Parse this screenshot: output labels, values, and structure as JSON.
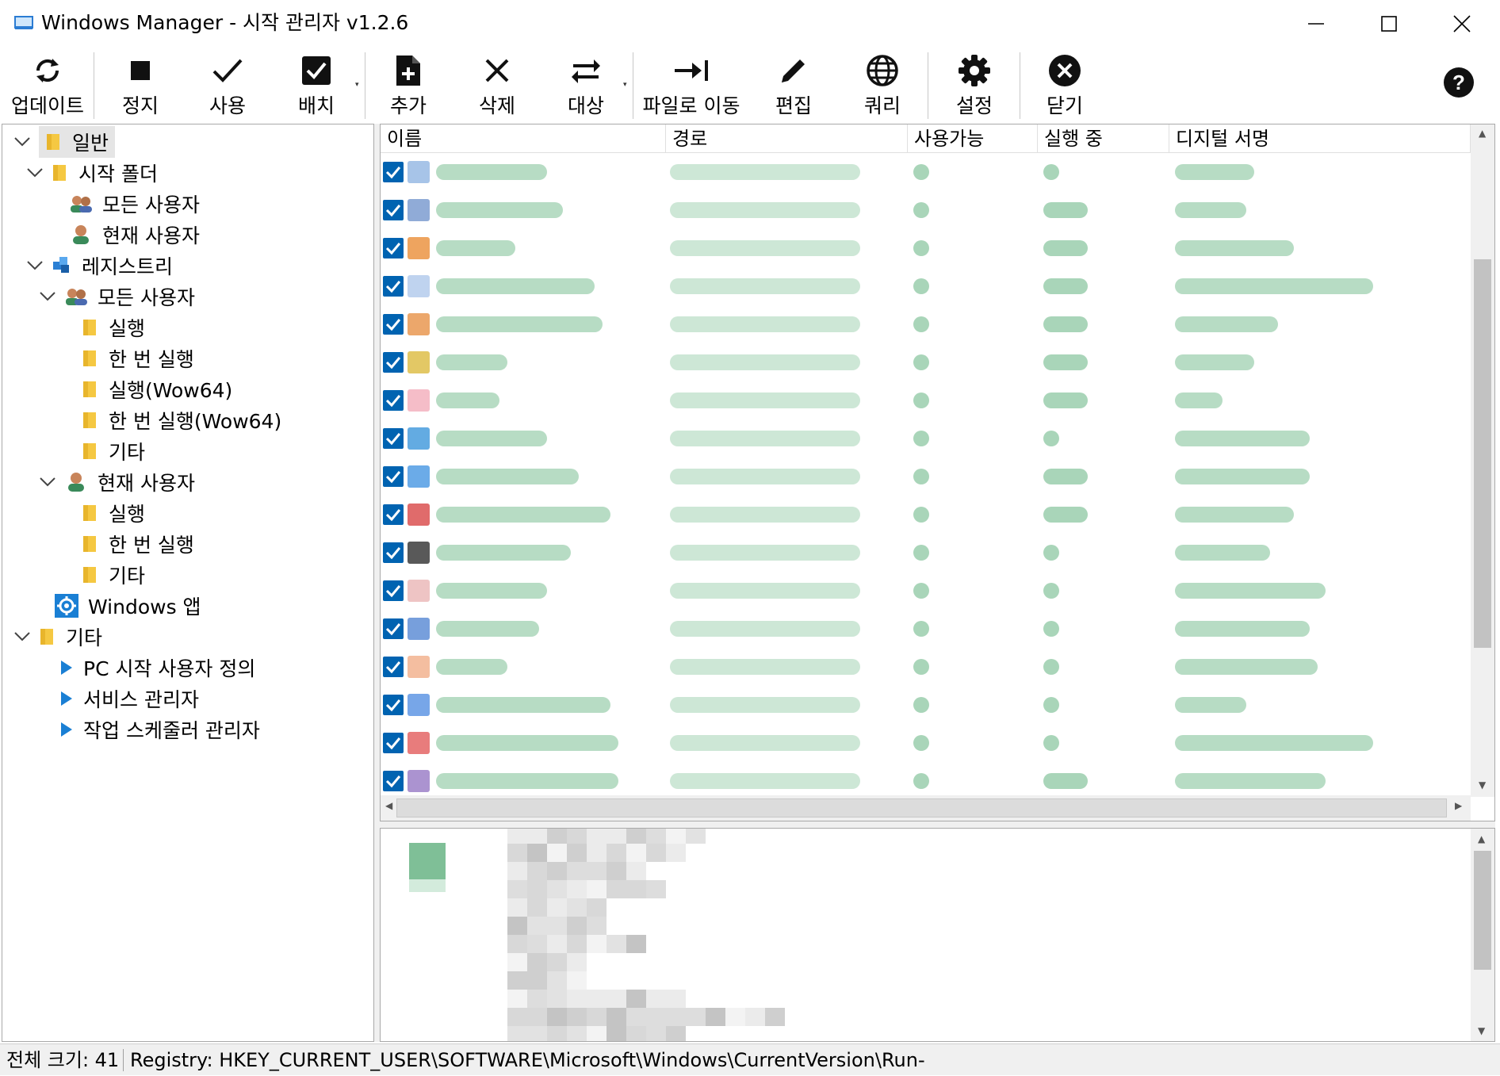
{
  "window": {
    "title": "Windows Manager - 시작 관리자 v1.2.6"
  },
  "toolbar": {
    "buttons": [
      {
        "label": "업데이트",
        "icon": "refresh-icon"
      },
      {
        "label": "정지",
        "icon": "stop-icon"
      },
      {
        "label": "사용",
        "icon": "checkmark-icon"
      },
      {
        "label": "배치",
        "icon": "checkbox-icon"
      },
      {
        "label": "추가",
        "icon": "file-add-icon"
      },
      {
        "label": "삭제",
        "icon": "x-icon"
      },
      {
        "label": "대상",
        "icon": "swap-arrows-icon"
      },
      {
        "label": "파일로 이동",
        "icon": "arrow-to-line-icon"
      },
      {
        "label": "편집",
        "icon": "pencil-icon"
      },
      {
        "label": "쿼리",
        "icon": "globe-icon"
      },
      {
        "label": "설정",
        "icon": "gear-icon"
      },
      {
        "label": "닫기",
        "icon": "close-circle-icon"
      }
    ],
    "help_icon": "help-icon"
  },
  "tree": {
    "items": [
      {
        "label": "일반"
      },
      {
        "label": "시작 폴더"
      },
      {
        "label": "모든 사용자"
      },
      {
        "label": "현재 사용자"
      },
      {
        "label": "레지스트리"
      },
      {
        "label": "모든 사용자"
      },
      {
        "label": "실행"
      },
      {
        "label": "한 번 실행"
      },
      {
        "label": "실행(Wow64)"
      },
      {
        "label": "한 번 실행(Wow64)"
      },
      {
        "label": "기타"
      },
      {
        "label": "현재 사용자"
      },
      {
        "label": "실행"
      },
      {
        "label": "한 번 실행"
      },
      {
        "label": "기타"
      },
      {
        "label": "Windows 앱"
      },
      {
        "label": "기타"
      },
      {
        "label": "PC 시작 사용자 정의"
      },
      {
        "label": "서비스 관리자"
      },
      {
        "label": "작업 스케줄러 관리자"
      }
    ]
  },
  "list": {
    "columns": [
      "이름",
      "경로",
      "사용가능",
      "실행 중",
      "디지털 서명"
    ],
    "row_count": 17
  },
  "status": {
    "total": "전체 크기: 41",
    "registry": "Registry: HKEY_CURRENT_USER\\SOFTWARE\\Microsoft\\Windows\\CurrentVersion\\Run-"
  },
  "colors": {
    "accent": "#0063b1",
    "folder": "#f5c842",
    "tree_arrow": "#1a7fd4"
  }
}
